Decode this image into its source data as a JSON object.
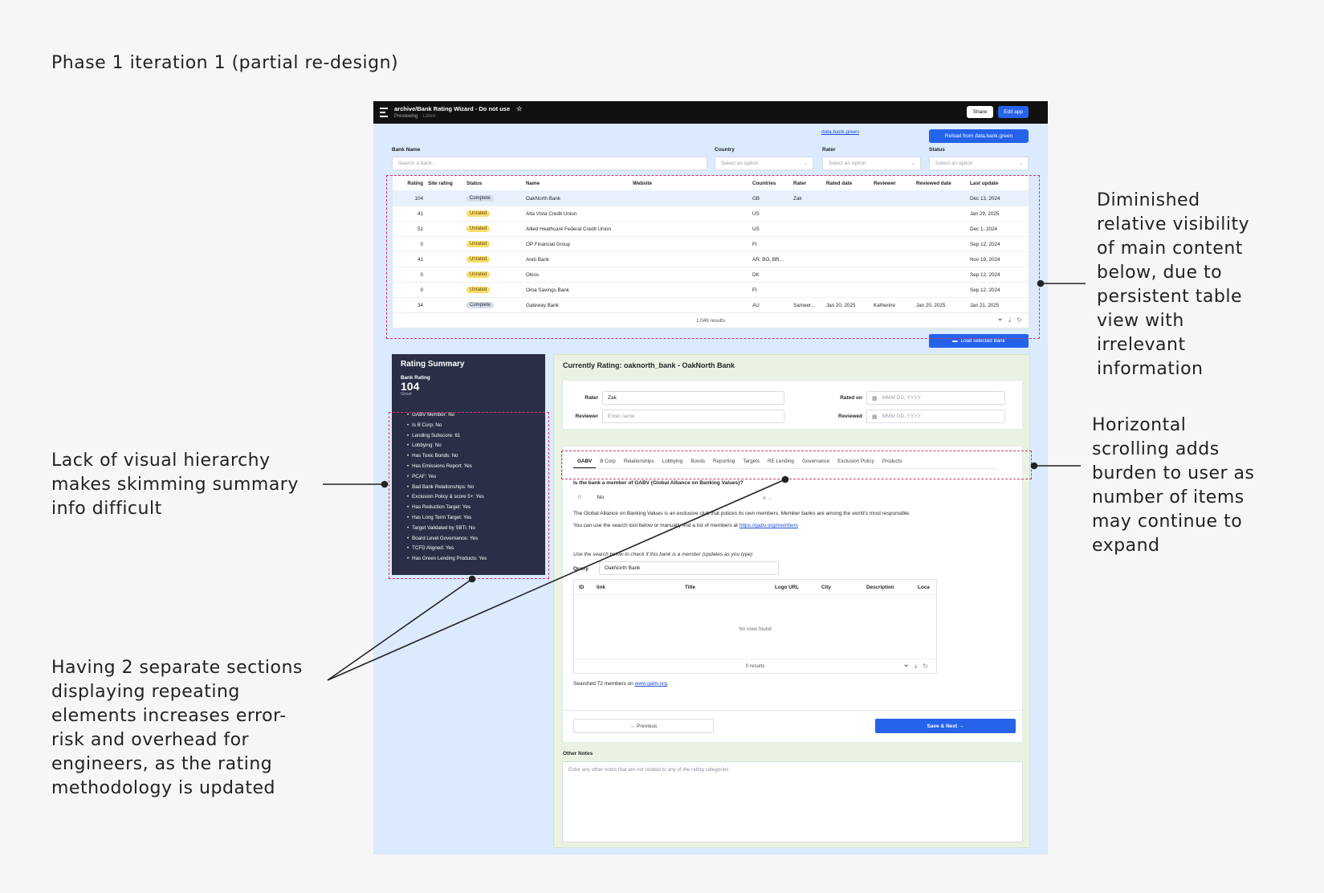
{
  "page_title": "Phase 1 iteration 1 (partial re-design)",
  "annotations": {
    "table": "Diminished\nrelative visibility\nof main content\nbelow, due to\npersistent table\nview with\nirrelevant\ninformation",
    "tabs": "Horizontal\nscrolling adds\nburden to user as\nnumber of items\nmay continue to\nexpand",
    "summary": "Lack of visual hierarchy\nmakes skimming summary\ninfo difficult",
    "repeat": "Having 2 separate sections\ndisplaying repeating\nelements increases error-\nrisk and overhead for\nengineers, as the rating\nmethodology is updated"
  },
  "app": {
    "title": "archive/Bank Rating Wizard - Do not use",
    "sub_status": "Previewing",
    "sub_version": "Latest",
    "share_label": "Share",
    "edit_label": "Edit app",
    "data_link": "data.bank.green",
    "reload_label": "Reload from data.bank.green",
    "filters": {
      "bank_name_label": "Bank Name",
      "bank_name_placeholder": "Search a bank...",
      "country_label": "Country",
      "country_placeholder": "Select an option",
      "rater_label": "Rater",
      "rater_placeholder": "Select an option",
      "status_label": "Status",
      "status_placeholder": "Select an option"
    },
    "table": {
      "columns": [
        "Rating",
        "Site rating",
        "Status",
        "Name",
        "Website",
        "Countries",
        "Rater",
        "Rated date",
        "Reviewer",
        "Reviewed date",
        "Last update"
      ],
      "rows": [
        {
          "rating": "104",
          "site": "",
          "status": "Complete",
          "name": "OakNorth Bank",
          "website": "",
          "countries": "GB",
          "rater": "Zak",
          "rated": "",
          "reviewer": "",
          "reviewed": "",
          "updated": "Dec 13, 2024"
        },
        {
          "rating": "41",
          "site": "",
          "status": "Unrated",
          "name": "Alta Vista Credit Union",
          "website": "",
          "countries": "US",
          "rater": "",
          "rated": "",
          "reviewer": "",
          "reviewed": "",
          "updated": "Jan 29, 2025"
        },
        {
          "rating": "51",
          "site": "",
          "status": "Unrated",
          "name": "Allied Heathcare Federal Credit Union",
          "website": "",
          "countries": "US",
          "rater": "",
          "rated": "",
          "reviewer": "",
          "reviewed": "",
          "updated": "Dec 1, 2024"
        },
        {
          "rating": "0",
          "site": "",
          "status": "Unrated",
          "name": "OP Financial Group",
          "website": "",
          "countries": "FI",
          "rater": "",
          "rated": "",
          "reviewer": "",
          "reviewed": "",
          "updated": "Sep 12, 2024"
        },
        {
          "rating": "41",
          "site": "",
          "status": "Unrated",
          "name": "Areti Bank",
          "website": "",
          "countries": "AR, BO, BR...",
          "rater": "",
          "rated": "",
          "reviewer": "",
          "reviewed": "",
          "updated": "Nov 19, 2024"
        },
        {
          "rating": "0",
          "site": "",
          "status": "Unrated",
          "name": "Oikos",
          "website": "",
          "countries": "DK",
          "rater": "",
          "rated": "",
          "reviewer": "",
          "reviewed": "",
          "updated": "Sep 12, 2024"
        },
        {
          "rating": "0",
          "site": "",
          "status": "Unrated",
          "name": "Oma Savings Bank",
          "website": "",
          "countries": "FI",
          "rater": "",
          "rated": "",
          "reviewer": "",
          "reviewed": "",
          "updated": "Sep 12, 2024"
        },
        {
          "rating": "34",
          "site": "",
          "status": "Complete",
          "name": "Gateway Bank",
          "website": "",
          "countries": "AU",
          "rater": "Sameer...",
          "rated": "Jan 20, 2025",
          "reviewer": "Katherine",
          "reviewed": "Jan 20, 2025",
          "updated": "Jan 21, 2025"
        }
      ],
      "results": "1,046 results"
    },
    "load_label": "Load selected Bank",
    "summary": {
      "title": "Rating Summary",
      "bank_rating_label": "Bank Rating",
      "bank_rating_value": "104",
      "bank_rating_grade": "Great",
      "items": [
        "GABV Member: No",
        "Is B Corp: No",
        "Lending Subscore: 61",
        "Lobbying: No",
        "Has Toxic Bonds: No",
        "Has Emissions Report: Yes",
        "PCAF: Yes",
        "Bad Bank Relationships: No",
        "Exclusion Policy & score 5+: Yes",
        "Has Reduction Target: Yes",
        "Has Long Term Target: Yes",
        "Target Validated by SBTi: No",
        "Board Level Governance: Yes",
        "TCFD Aligned: Yes",
        "Has Green Lending Products: Yes"
      ]
    },
    "current": {
      "title": "Currently Rating: oaknorth_bank - OakNorth Bank",
      "rater_label": "Rater",
      "rater_value": "Zak",
      "reviewer_label": "Reviewer",
      "reviewer_placeholder": "Enter name",
      "rated_on_label": "Rated on",
      "rated_on_placeholder": "MMM DD, YYYY",
      "reviewed_label": "Reviewed",
      "reviewed_placeholder": "MMM DD, YYYY",
      "tabs": [
        "GABV",
        "B Corp",
        "Relationships",
        "Lobbying",
        "Bonds",
        "Reporting",
        "Targets",
        "RE Lending",
        "Governance",
        "Exclusion Policy",
        "Products"
      ],
      "question": "Is the bank a member of GABV (Global Alliance on Banking Values)?",
      "select_prefix": "0",
      "select_value": "No",
      "info_text": "The Global Alliance on Banking Values is an exclusive club that polices its own members. Member banks are among the world's most responsible.",
      "search_hint_text": "You can use the search tool below or manually find a list of members at",
      "search_hint_link": "https://gabv.org/members",
      "instruction": "Use the search below to check if this bank is a member (updates as you type)",
      "query_label": "Query",
      "query_value": "OakNorth Bank",
      "inner_columns": [
        "ID",
        "link",
        "Title",
        "Logo URL",
        "City",
        "Description",
        "Loca"
      ],
      "no_rows": "No rows found",
      "inner_results": "0 results",
      "searched_text": "Searched 72 members on",
      "searched_link": "www.gabv.org",
      "prev_label": "← Previous",
      "next_label": "Save & Next →",
      "notes_label": "Other Notes",
      "notes_placeholder": "Enter any other notes that are not related to any of the rating categories"
    }
  }
}
